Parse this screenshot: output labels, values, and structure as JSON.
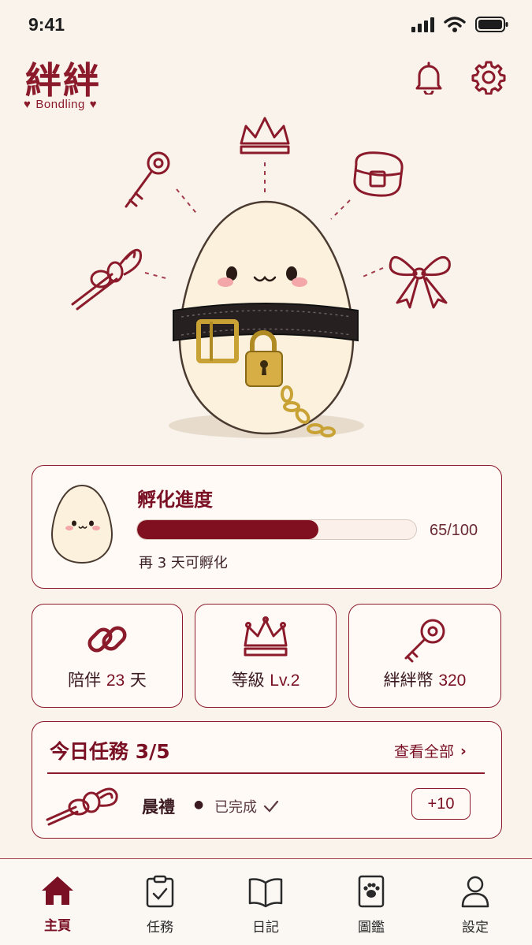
{
  "status_bar": {
    "time": "9:41"
  },
  "brand": {
    "title": "絆絆",
    "subtitle": "Bondling"
  },
  "progress": {
    "title": "孵化進度",
    "value": 65,
    "max": 100,
    "display": "65/100",
    "note": "再 3 天可孵化"
  },
  "stats": [
    {
      "label": "陪伴",
      "value": "23",
      "unit": "天",
      "icon": "chain-link-icon"
    },
    {
      "label": "等級",
      "value": "Lv.2",
      "unit": "",
      "icon": "crown-icon"
    },
    {
      "label": "絆絆幣",
      "value": "320",
      "unit": "",
      "icon": "key-icon"
    }
  ],
  "tasks": {
    "title": "今日任務 3/5",
    "view_all": "查看全部",
    "item": {
      "name": "晨禮",
      "status": "已完成",
      "reward": "+10",
      "icon": "rope-knot-icon"
    }
  },
  "tabs": [
    {
      "label": "主頁",
      "icon": "home-icon",
      "active": true
    },
    {
      "label": "任務",
      "icon": "clipboard-icon",
      "active": false
    },
    {
      "label": "日記",
      "icon": "book-icon",
      "active": false
    },
    {
      "label": "圖鑑",
      "icon": "paw-book-icon",
      "active": false
    },
    {
      "label": "設定",
      "icon": "user-icon",
      "active": false
    }
  ],
  "colors": {
    "accent": "#8b1a2b",
    "background": "#f9f3ec",
    "gold": "#c9a236"
  }
}
